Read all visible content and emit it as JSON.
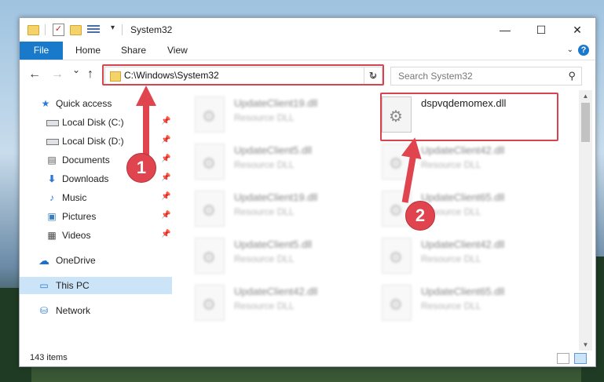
{
  "window": {
    "title": "System32",
    "minimize": "—",
    "maximize": "☐",
    "close": "✕"
  },
  "ribbon": {
    "file": "File",
    "home": "Home",
    "share": "Share",
    "view": "View",
    "help": "?"
  },
  "nav": {
    "back": "←",
    "forward": "→",
    "recent": "⌄",
    "up": "↑",
    "address": "C:\\Windows\\System32",
    "search_placeholder": "Search System32"
  },
  "sidebar": {
    "items": [
      {
        "label": "Quick access",
        "icon": "star-icon"
      },
      {
        "label": "Local Disk (C:)",
        "icon": "disk-icon"
      },
      {
        "label": "Local Disk (D:)",
        "icon": "disk-icon"
      },
      {
        "label": "Documents",
        "icon": "documents-icon"
      },
      {
        "label": "Downloads",
        "icon": "downloads-icon"
      },
      {
        "label": "Music",
        "icon": "music-icon"
      },
      {
        "label": "Pictures",
        "icon": "pictures-icon"
      },
      {
        "label": "Videos",
        "icon": "videos-icon"
      },
      {
        "label": "OneDrive",
        "icon": "cloud-icon"
      },
      {
        "label": "This PC",
        "icon": "computer-icon"
      },
      {
        "label": "Network",
        "icon": "network-icon"
      }
    ]
  },
  "files": [
    {
      "name": "UpdateClient19.dll",
      "type": "Resource DLL"
    },
    {
      "name": "dspvqdemomex.dll",
      "type": ""
    },
    {
      "name": "UpdateClient5.dll",
      "type": "Resource DLL"
    },
    {
      "name": "UpdateClient42.dll",
      "type": "Resource DLL"
    },
    {
      "name": "UpdateClient19.dll",
      "type": "Resource DLL"
    },
    {
      "name": "UpdateClient65.dll",
      "type": "Resource DLL"
    },
    {
      "name": "UpdateClient5.dll",
      "type": "Resource DLL"
    },
    {
      "name": "UpdateClient42.dll",
      "type": "Resource DLL"
    },
    {
      "name": "UpdateClient42.dll",
      "type": "Resource DLL"
    },
    {
      "name": "UpdateClient65.dll",
      "type": "Resource DLL"
    }
  ],
  "status": {
    "count": "143 items"
  },
  "annotations": {
    "step1": "1",
    "step2": "2",
    "color": "#e0454f"
  }
}
